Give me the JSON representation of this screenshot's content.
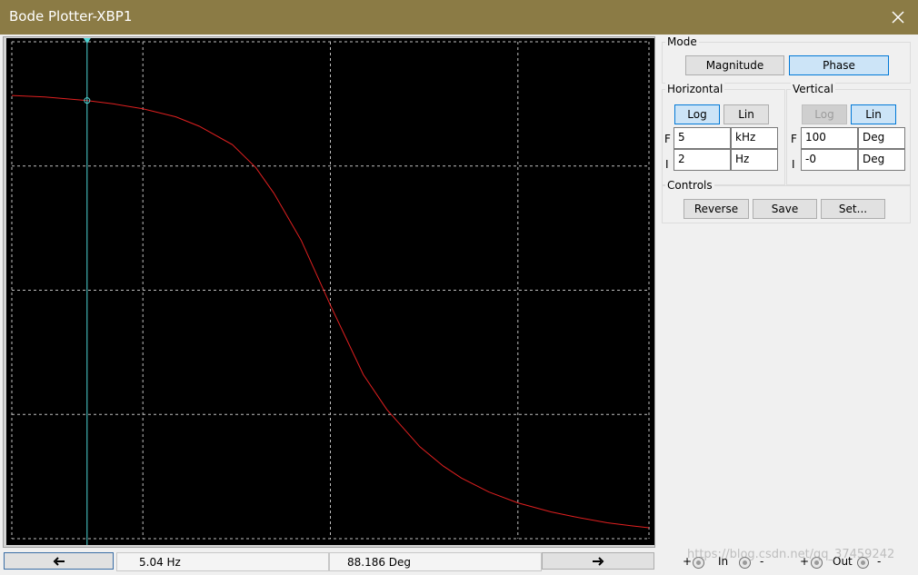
{
  "window": {
    "title": "Bode Plotter-XBP1",
    "close_icon": "close-icon"
  },
  "mode": {
    "label": "Mode",
    "magnitude": "Magnitude",
    "phase": "Phase",
    "selected": "Phase"
  },
  "horizontal": {
    "label": "Horizontal",
    "log": "Log",
    "lin": "Lin",
    "selected": "Log",
    "f_label": "F",
    "f_value": "5",
    "f_unit": "kHz",
    "i_label": "I",
    "i_value": "2",
    "i_unit": "Hz"
  },
  "vertical": {
    "label": "Vertical",
    "log": "Log",
    "lin": "Lin",
    "selected": "Lin",
    "f_label": "F",
    "f_value": "100",
    "f_unit": "Deg",
    "i_label": "I",
    "i_value": "-0",
    "i_unit": "Deg"
  },
  "controls": {
    "label": "Controls",
    "reverse": "Reverse",
    "save": "Save",
    "set": "Set..."
  },
  "readout": {
    "frequency": "5.04  Hz",
    "value": "88.186 Deg"
  },
  "terminals": {
    "plus": "+",
    "minus": "-",
    "in": "In",
    "out": "Out"
  },
  "watermark": "https://blog.csdn.net/qq_37459242",
  "colors": {
    "trace": "#e02020",
    "cursor": "#4fd6d6",
    "grid": "#bfbfbf",
    "titlebar": "#8b7b45"
  },
  "chart_data": {
    "type": "line",
    "xscale": "log",
    "xlim": [
      2,
      5000
    ],
    "ylim": [
      0,
      100
    ],
    "yunit": "Deg",
    "grid": true,
    "cursor_x": 5.04,
    "cursor_y": 88.186,
    "series": [
      {
        "x": [
          2,
          3,
          5,
          7,
          10,
          15,
          20,
          30,
          40,
          50,
          70,
          100,
          150,
          200,
          300,
          400,
          500,
          700,
          1000,
          1500,
          2000,
          3000,
          4000,
          5000
        ],
        "y": [
          89.2,
          88.9,
          88.19,
          87.5,
          86.5,
          84.9,
          83.0,
          79.3,
          74.7,
          69.5,
          60.0,
          47.0,
          33.0,
          26.0,
          18.5,
          14.6,
          12.2,
          9.4,
          7.2,
          5.4,
          4.4,
          3.2,
          2.6,
          2.2
        ]
      }
    ]
  }
}
